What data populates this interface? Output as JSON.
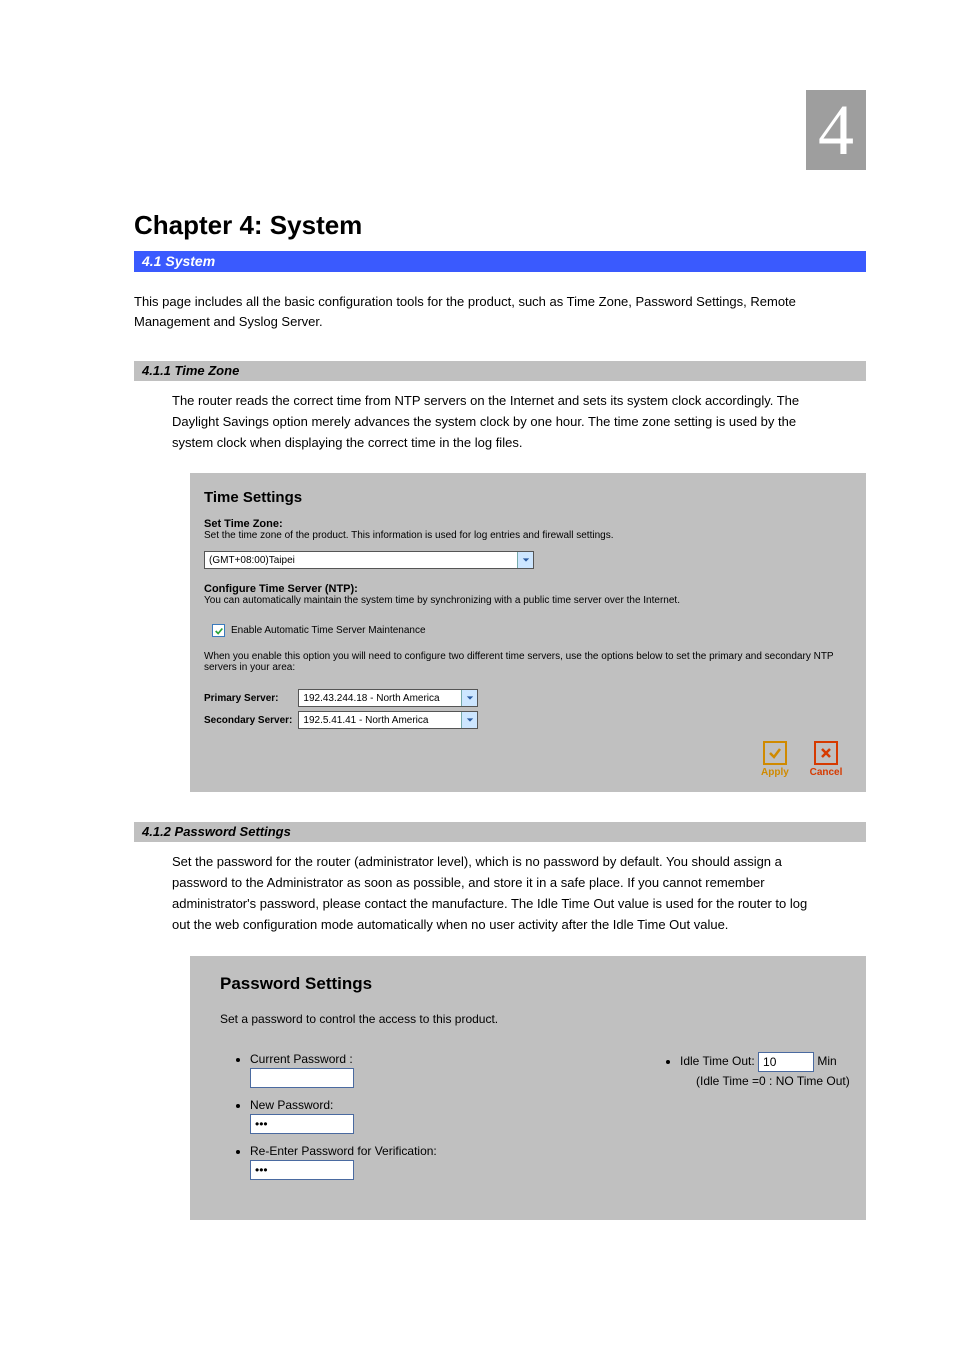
{
  "chapter": {
    "number": "4",
    "title": "Chapter 4: System"
  },
  "blue_bar_label": "4.1 System",
  "system_intro": "This page includes all the basic configuration tools for the product, such as Time Zone, Password Settings, Remote Management and Syslog Server.",
  "sections": {
    "time": {
      "bar": "4.1.1 Time Zone",
      "intro": "The router reads the correct time from NTP servers on the Internet and sets its system clock accordingly. The Daylight Savings option merely advances the system clock by one hour. The time zone setting is used by the system clock when displaying the correct time in the log files.",
      "panel": {
        "title": "Time Settings",
        "stz_label": "Set Time Zone:",
        "stz_desc": "Set the time zone of the product. This information is used for log entries and firewall settings.",
        "tz_select_value": "(GMT+08:00)Taipei",
        "ntp_label": "Configure Time Server (NTP):",
        "ntp_desc": "You can automatically maintain the system time by synchronizing with a public time server over the Internet.",
        "cb_label": "Enable Automatic Time Server Maintenance",
        "cb_checked": true,
        "servers_note": "When you enable this option you will need to configure two different time servers, use the options below to set the primary and secondary NTP servers in your area:",
        "primary_label": "Primary Server:",
        "primary_value": "192.43.244.18 - North America",
        "secondary_label": "Secondary Server:",
        "secondary_value": "192.5.41.41 - North America",
        "apply_label": "Apply",
        "cancel_label": "Cancel"
      }
    },
    "pwd": {
      "bar": "4.1.2 Password Settings",
      "intro": "Set the password for the router (administrator level), which is no password by default. You should assign a password to the Administrator as soon as possible, and store it in a safe place. If you cannot remember administrator's password, please contact the manufacture. The Idle Time Out value is used for the router to log out the web configuration mode automatically when no user activity after the Idle Time Out value.",
      "panel": {
        "title": "Password Settings",
        "sub": "Set a password to control the access to this product.",
        "current_label": "Current Password :",
        "current_value": "",
        "new_label": "New Password:",
        "new_value": "•••",
        "re_label": "Re-Enter Password for Verification:",
        "re_value": "•••",
        "idle_label": "Idle Time Out:",
        "idle_value": "10",
        "idle_unit": "Min",
        "idle_hint": "(Idle Time =0 : NO Time Out)"
      }
    }
  }
}
